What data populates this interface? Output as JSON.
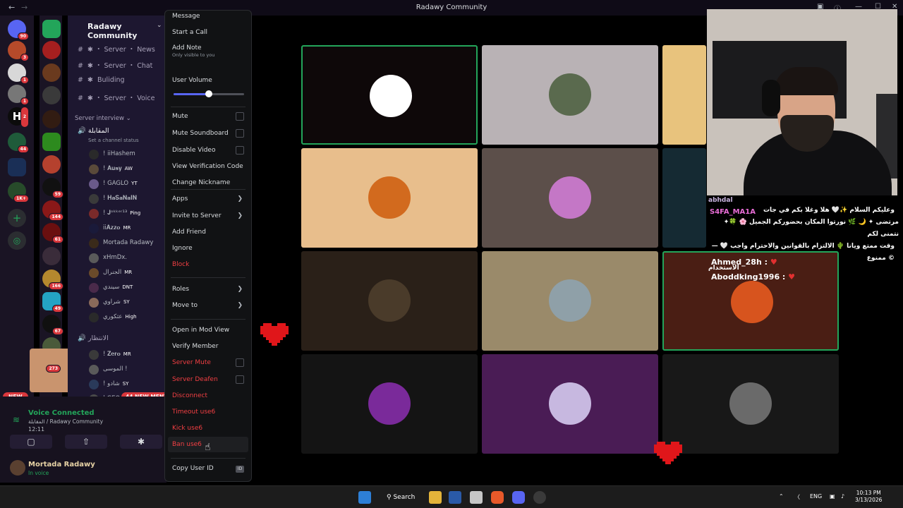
{
  "window": {
    "title": "Radawy Community"
  },
  "server": {
    "name": "Radawy Community",
    "channels": [
      {
        "label": "✱ ・ Server ・ News"
      },
      {
        "label": "✱ ・ Server ・ Chat"
      },
      {
        "label": "Buliding"
      },
      {
        "label": "✱ ・ Server ・ Voice"
      }
    ],
    "category1": "Server interview",
    "voice_channel": "المقابلة",
    "channel_status": "Set a channel status",
    "voice_users": [
      {
        "name": "! iiHashem",
        "tag": ""
      },
      {
        "name": "! 𝐀𝐮𝐬𝐲",
        "tag": "AW"
      },
      {
        "name": "! GAGLO",
        "tag": "YT"
      },
      {
        "name": "! 𝐇𝐚𝐒𝐚𝐍𝐚𝐈𝐍",
        "tag": ""
      },
      {
        "name": "! 𝐉ᵒᵏᵏᵉʳ¹³",
        "tag": "Ping"
      },
      {
        "name": "ii𝐀𝐳𝐳𝐨",
        "tag": "MR"
      },
      {
        "name": "Mortada Radawy",
        "tag": ""
      },
      {
        "name": "xHmDx.",
        "tag": ""
      },
      {
        "name": "الجنرال",
        "tag": "MR"
      },
      {
        "name": "سيندي",
        "tag": "DNT"
      },
      {
        "name": "شراوي",
        "tag": "SY"
      },
      {
        "name": "عثكوري",
        "tag": "High"
      }
    ],
    "voice_channel2": "الانتظار",
    "voice_users2": [
      {
        "name": "! 𝐙𝐞𝐫𝐨",
        "tag": "MR"
      },
      {
        "name": "الموسى !",
        "tag": ""
      },
      {
        "name": "! شادو",
        "tag": "SY"
      },
      {
        "name": "| GEO_",
        "tag": ""
      }
    ]
  },
  "guild_badges": [
    "90",
    "3",
    "1",
    "1",
    "1",
    "2",
    "44",
    "1K+",
    "59",
    "144",
    "61",
    "166",
    "49",
    "67",
    "273"
  ],
  "pills": {
    "new": "NEW",
    "mentions": "44 NEW MENT"
  },
  "voice": {
    "status": "Voice Connected",
    "location": "المقابلة / Radawy Community",
    "time": "12:11"
  },
  "user": {
    "name": "Mortada Radawy",
    "status": "In voice"
  },
  "context_menu": {
    "items": {
      "message": "Message",
      "start_call": "Start a Call",
      "add_note": "Add Note",
      "add_note_sub": "Only visible to you",
      "user_volume": "User Volume",
      "mute": "Mute",
      "mute_soundboard": "Mute Soundboard",
      "disable_video": "Disable Video",
      "view_verification": "View Verification Code",
      "change_nickname": "Change Nickname",
      "apps": "Apps",
      "invite": "Invite to Server",
      "add_friend": "Add Friend",
      "ignore": "Ignore",
      "block": "Block",
      "roles": "Roles",
      "move_to": "Move to",
      "open_mod": "Open in Mod View",
      "verify": "Verify Member",
      "server_mute": "Server Mute",
      "server_deafen": "Server Deafen",
      "disconnect": "Disconnect",
      "timeout": "Timeout use6",
      "kick": "Kick use6",
      "ban": "Ban use6",
      "copy_id": "Copy User ID",
      "id_badge": "ID"
    },
    "user_volume_level": 0.5
  },
  "stream_overlay": {
    "chat_lines": [
      "وعليكم السلام ✨🤍 هلا وغلا بكم في جات",
      "✦مرتضى ✦ 🌙 🌿 نورتوا المكان بحضوركم الجميل 🌸 🍀 نتمنى لكم",
      "وقت ممتع ويانا 🌵 الالتزام بالقوانين والاحترام واجب 🤍 — © ممنوع",
      "الاستخدام"
    ],
    "name_top": "S4FA_MA1A",
    "name_cut": "abhdal",
    "followers": [
      "Ahmed_28h :",
      "Aboddking1996 :"
    ]
  },
  "tiles": [
    {
      "name": "hashem",
      "bg": "#0e0809",
      "av": "#ffffff",
      "speaking": true
    },
    {
      "name": "masked",
      "bg": "#b9b2b5",
      "av": "#5a6a4e",
      "speaking": false
    },
    {
      "name": "yellow",
      "bg": "#e8c37d",
      "av": "",
      "speaking": false
    },
    {
      "name": "pumpkin",
      "bg": "#e8be8c",
      "av": "#d26a1e",
      "speaking": false
    },
    {
      "name": "selfie",
      "bg": "#5c4f4a",
      "av": "#c477c6",
      "speaking": false
    },
    {
      "name": "dark-blue",
      "bg": "#152a33",
      "av": "",
      "speaking": false
    },
    {
      "name": "suit",
      "bg": "#2a2018",
      "av": "#4a3b2a",
      "speaking": false
    },
    {
      "name": "scene",
      "bg": "#9a8a6a",
      "av": "#8fa0a8",
      "speaking": false
    },
    {
      "name": "revl",
      "bg": "#4a1e14",
      "av": "#d7541e",
      "speaking": true
    },
    {
      "name": "purple-car",
      "bg": "#141414",
      "av": "#7a2a9a",
      "speaking": false
    },
    {
      "name": "anime",
      "bg": "#4a1c55",
      "av": "#c7b8e0",
      "speaking": false
    },
    {
      "name": "mono",
      "bg": "#181818",
      "av": "#6a6a6a",
      "speaking": false
    }
  ],
  "taskbar": {
    "search": "Search",
    "lang": "ENG",
    "time": "10:13 PM",
    "date": "3/13/2026"
  }
}
